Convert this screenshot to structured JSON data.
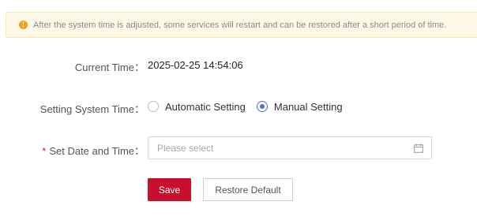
{
  "notice": {
    "icon": "info-exclamation-icon",
    "text": "After the system time is adjusted, some services will restart and can be restored after a short period of time."
  },
  "current_time": {
    "label": "Current Time：",
    "value": "2025-02-25 14:54:06"
  },
  "setting_mode": {
    "label": "Setting System Time：",
    "options": [
      {
        "label": "Automatic Setting",
        "selected": false
      },
      {
        "label": "Manual Setting",
        "selected": true
      }
    ]
  },
  "date_time": {
    "required_mark": "*",
    "label": "Set Date and Time：",
    "placeholder": "Please select",
    "icon": "calendar-icon"
  },
  "actions": {
    "save_label": "Save",
    "restore_label": "Restore Default"
  },
  "colors": {
    "primary": "#c8102e",
    "radio_accent": "#4a6fe3",
    "warning": "#f0a020",
    "required": "#e5212d"
  }
}
